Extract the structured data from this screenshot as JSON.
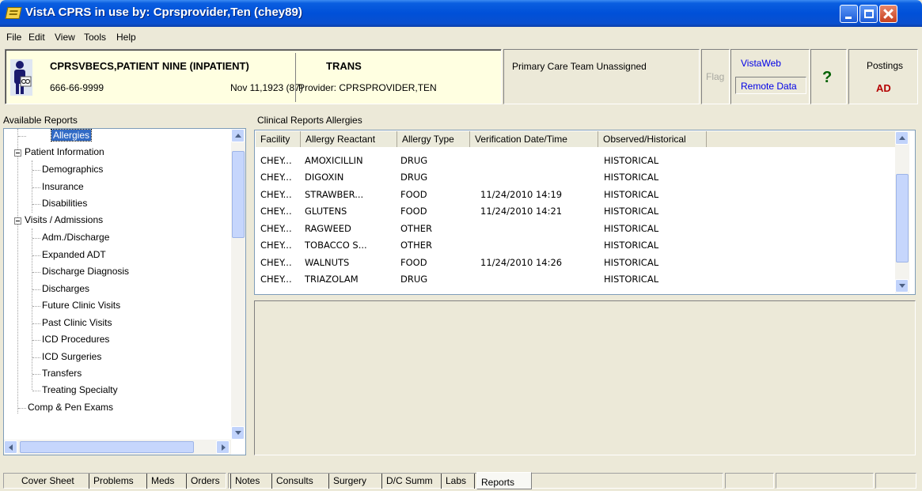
{
  "window": {
    "title": "VistA CPRS in use by: Cprsprovider,Ten  (chey89)"
  },
  "menu": [
    "File",
    "Edit",
    "View",
    "Tools",
    "Help"
  ],
  "patient": {
    "name": "CPRSVBECS,PATIENT NINE (INPATIENT)",
    "ssn": "666-66-9999",
    "dob": "Nov 11,1923 (87)",
    "location": "TRANS",
    "provider": "Provider:  CPRSPROVIDER,TEN",
    "primary_care": "Primary Care Team Unassigned",
    "flag_label": "Flag",
    "vistaweb_label": "VistaWeb",
    "remote_data_label": "Remote Data",
    "help_icon": "?",
    "postings_label": "Postings",
    "postings_value": "AD"
  },
  "reports_tree": {
    "label": "Available Reports",
    "items": [
      {
        "label": "Allergies",
        "level": 1,
        "selected": true
      },
      {
        "label": "Patient Information",
        "level": 0,
        "expander": true
      },
      {
        "label": "Demographics",
        "level": 1
      },
      {
        "label": "Insurance",
        "level": 1
      },
      {
        "label": "Disabilities",
        "level": 1
      },
      {
        "label": "Visits / Admissions",
        "level": 0,
        "expander": true
      },
      {
        "label": "Adm./Discharge",
        "level": 1
      },
      {
        "label": "Expanded ADT",
        "level": 1
      },
      {
        "label": "Discharge Diagnosis",
        "level": 1
      },
      {
        "label": "Discharges",
        "level": 1
      },
      {
        "label": "Future Clinic Visits",
        "level": 1
      },
      {
        "label": "Past Clinic Visits",
        "level": 1
      },
      {
        "label": "ICD Procedures",
        "level": 1
      },
      {
        "label": "ICD Surgeries",
        "level": 1
      },
      {
        "label": "Transfers",
        "level": 1
      },
      {
        "label": "Treating Specialty",
        "level": 1
      },
      {
        "label": "Comp & Pen Exams",
        "level": 0
      }
    ]
  },
  "report": {
    "title": "Clinical Reports Allergies",
    "columns": [
      "Facility",
      "Allergy Reactant",
      "Allergy Type",
      "Verification Date/Time",
      "Observed/Historical"
    ],
    "rows": [
      [
        "CHEY...",
        "AMOXICILLIN",
        "DRUG",
        "",
        "HISTORICAL"
      ],
      [
        "CHEY...",
        "DIGOXIN",
        "DRUG",
        "",
        "HISTORICAL"
      ],
      [
        "CHEY...",
        "STRAWBER...",
        "FOOD",
        "11/24/2010 14:19",
        "HISTORICAL"
      ],
      [
        "CHEY...",
        "GLUTENS",
        "FOOD",
        "11/24/2010 14:21",
        "HISTORICAL"
      ],
      [
        "CHEY...",
        "RAGWEED",
        "OTHER",
        "",
        "HISTORICAL"
      ],
      [
        "CHEY...",
        "TOBACCO S...",
        "OTHER",
        "",
        "HISTORICAL"
      ],
      [
        "CHEY...",
        "WALNUTS",
        "FOOD",
        "11/24/2010 14:26",
        "HISTORICAL"
      ],
      [
        "CHEY...",
        "TRIAZOLAM",
        "DRUG",
        "",
        "HISTORICAL"
      ]
    ]
  },
  "tabs": [
    "Cover Sheet",
    "Problems",
    "Meds",
    "Orders",
    "Notes",
    "Consults",
    "Surgery",
    "D/C Summ",
    "Labs",
    "Reports"
  ],
  "active_tab": "Reports"
}
